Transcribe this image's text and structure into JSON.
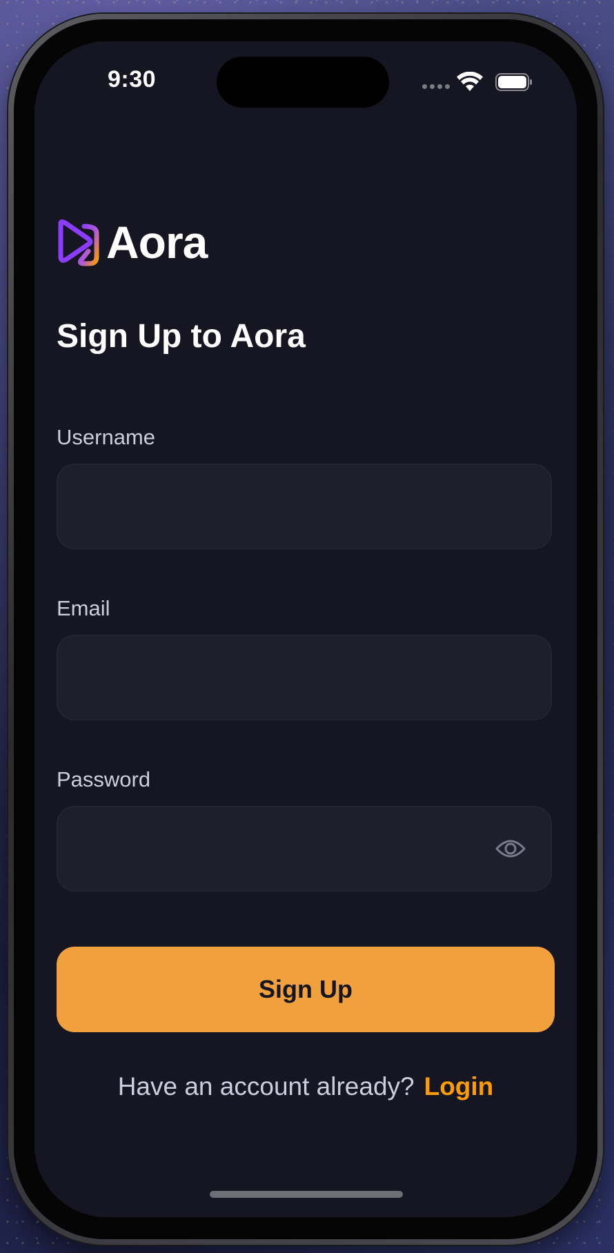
{
  "status_bar": {
    "time": "9:30"
  },
  "brand": {
    "name": "Aora",
    "logo_icon": "play-logo-icon",
    "gradient_colors": [
      "#8b3dff",
      "#ff9c01"
    ]
  },
  "page": {
    "title": "Sign Up to Aora"
  },
  "form": {
    "username": {
      "label": "Username",
      "value": ""
    },
    "email": {
      "label": "Email",
      "value": ""
    },
    "password": {
      "label": "Password",
      "value": "",
      "toggle_icon": "eye-icon"
    },
    "submit_label": "Sign Up"
  },
  "footer": {
    "prompt": "Have an account already?",
    "login_label": "Login"
  },
  "colors": {
    "background": "#161622",
    "accent": "#f0a03c",
    "link": "#ff9c01",
    "input_background": "#1e1e2d",
    "label_text": "#cdcde0"
  }
}
